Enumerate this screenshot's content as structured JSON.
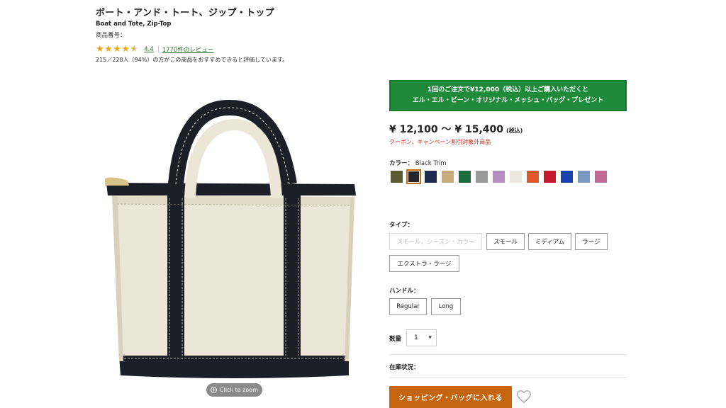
{
  "product": {
    "title_jp": "ボート・アンド・トート、ジップ・トップ",
    "title_en": "Boat and Tote, Zip-Top",
    "item_number_label": "商品番号：",
    "rating": {
      "stars": 4.4,
      "score": "4.4",
      "separator": "|",
      "review_count": "1770件のレビュー"
    },
    "recommend_text": "215／228人（94%）の方がこの商品をおすすめできると評価しています。"
  },
  "image": {
    "zoom_label": "Click to zoom"
  },
  "promo": {
    "line1": "1回のご注文で¥12,000（税込）以上ご購入いただくと",
    "line2": "エル・エル・ビーン・オリジナル・メッシュ・バッグ・プレゼント",
    "color": "#1f8b3a"
  },
  "price": {
    "range": "¥ 12,100 〜 ¥ 15,400",
    "tax_note": "(税込)",
    "coupon_note": "クーポン、キャンペーン割引対象外商品"
  },
  "color": {
    "label": "カラー：",
    "selected_name": "Black Trim",
    "swatches": [
      {
        "name": "olive",
        "hex": "#5d5a32"
      },
      {
        "name": "black-trim",
        "hex": "#22252d",
        "selected": true
      },
      {
        "name": "navy",
        "hex": "#1f2a4f"
      },
      {
        "name": "tan",
        "hex": "#c9aa7c"
      },
      {
        "name": "green",
        "hex": "#1b6b3e"
      },
      {
        "name": "gray",
        "hex": "#9a9a9a"
      },
      {
        "name": "lilac",
        "hex": "#b68fc1"
      },
      {
        "name": "natural",
        "hex": "#ece8df"
      },
      {
        "name": "orange",
        "hex": "#e0582a"
      },
      {
        "name": "red",
        "hex": "#c81a2c"
      },
      {
        "name": "blue",
        "hex": "#1b43b0"
      },
      {
        "name": "light-blue",
        "hex": "#7a9ac4"
      },
      {
        "name": "pink",
        "hex": "#c06b95"
      }
    ]
  },
  "type": {
    "label": "タイプ：",
    "placeholder": "スモール、シーズン・カラー",
    "options": [
      "スモール",
      "ミディアム",
      "ラージ",
      "エクストラ・ラージ"
    ]
  },
  "handle": {
    "label": "ハンドル：",
    "options": [
      "Regular",
      "Long"
    ]
  },
  "quantity": {
    "label": "数量",
    "value": "1"
  },
  "stock": {
    "label": "在庫状況："
  },
  "cart": {
    "button_label": "ショッピング・バッグに入れる",
    "accent": "#c5650f"
  }
}
